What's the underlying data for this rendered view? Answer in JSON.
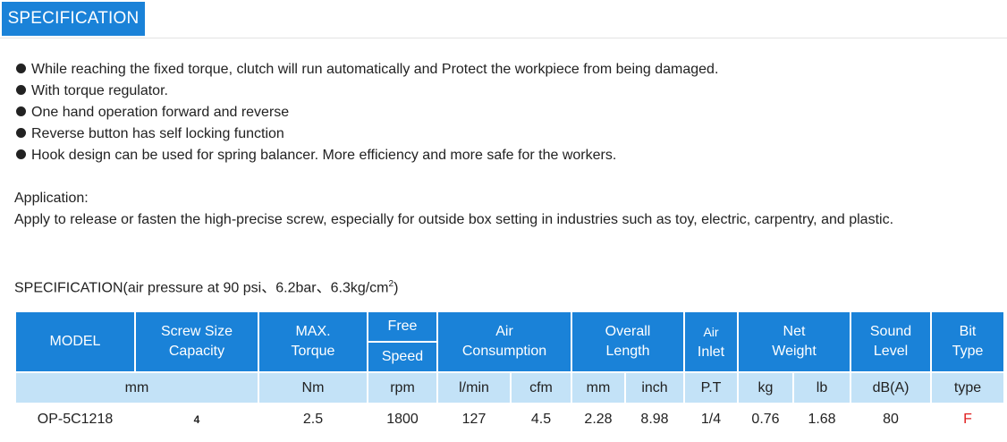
{
  "tab": {
    "label": "SPECIFICATION"
  },
  "features": [
    "While reaching the fixed torque, clutch will run automatically and Protect the workpiece from being damaged.",
    "With torque regulator.",
    "One hand operation forward and reverse",
    "Reverse button has self locking function",
    "Hook design can be used for spring balancer. More efficiency and more safe for the workers."
  ],
  "application": {
    "title": "Application:",
    "text": "Apply to release or fasten the high-precise screw, especially for outside box setting in industries such as toy, electric, carpentry, and plastic."
  },
  "spec_caption": {
    "prefix": "SPECIFICATION(air pressure at 90 psi、6.2bar、6.3kg/cm",
    "sup": "2",
    "suffix": ")"
  },
  "table": {
    "headers": {
      "model": "MODEL",
      "screw_size_1": "Screw Size",
      "screw_size_2": "Capacity",
      "max_torque_1": "MAX.",
      "max_torque_2": "Torque",
      "free": "Free",
      "speed": "Speed",
      "air_consumption_1": "Air",
      "air_consumption_2": "Consumption",
      "overall_length_1": "Overall",
      "overall_length_2": "Length",
      "air_inlet_1": "Air",
      "air_inlet_2": "Inlet",
      "net_weight_1": "Net",
      "net_weight_2": "Weight",
      "sound_level_1": "Sound",
      "sound_level_2": "Level",
      "bit_type_1": "Bit",
      "bit_type_2": "Type"
    },
    "units": [
      "mm",
      "Nm",
      "rpm",
      "l/min",
      "cfm",
      "mm",
      "inch",
      "P.T",
      "kg",
      "lb",
      "dB(A)",
      "type"
    ],
    "row": {
      "model": "OP-5C1218",
      "screw_size": "4",
      "max_torque": "2.5",
      "speed": "1800",
      "air_lmin": "127",
      "air_cfm": "4.5",
      "length_mm": "2.28",
      "length_inch": "8.98",
      "air_inlet": "1/4",
      "weight_kg": "0.76",
      "weight_lb": "1.68",
      "sound": "80",
      "bit_type": "F"
    }
  },
  "colors": {
    "header_blue": "#1a82d8",
    "unit_light_blue": "#c3e2f7",
    "bit_type_red": "#e02020"
  }
}
